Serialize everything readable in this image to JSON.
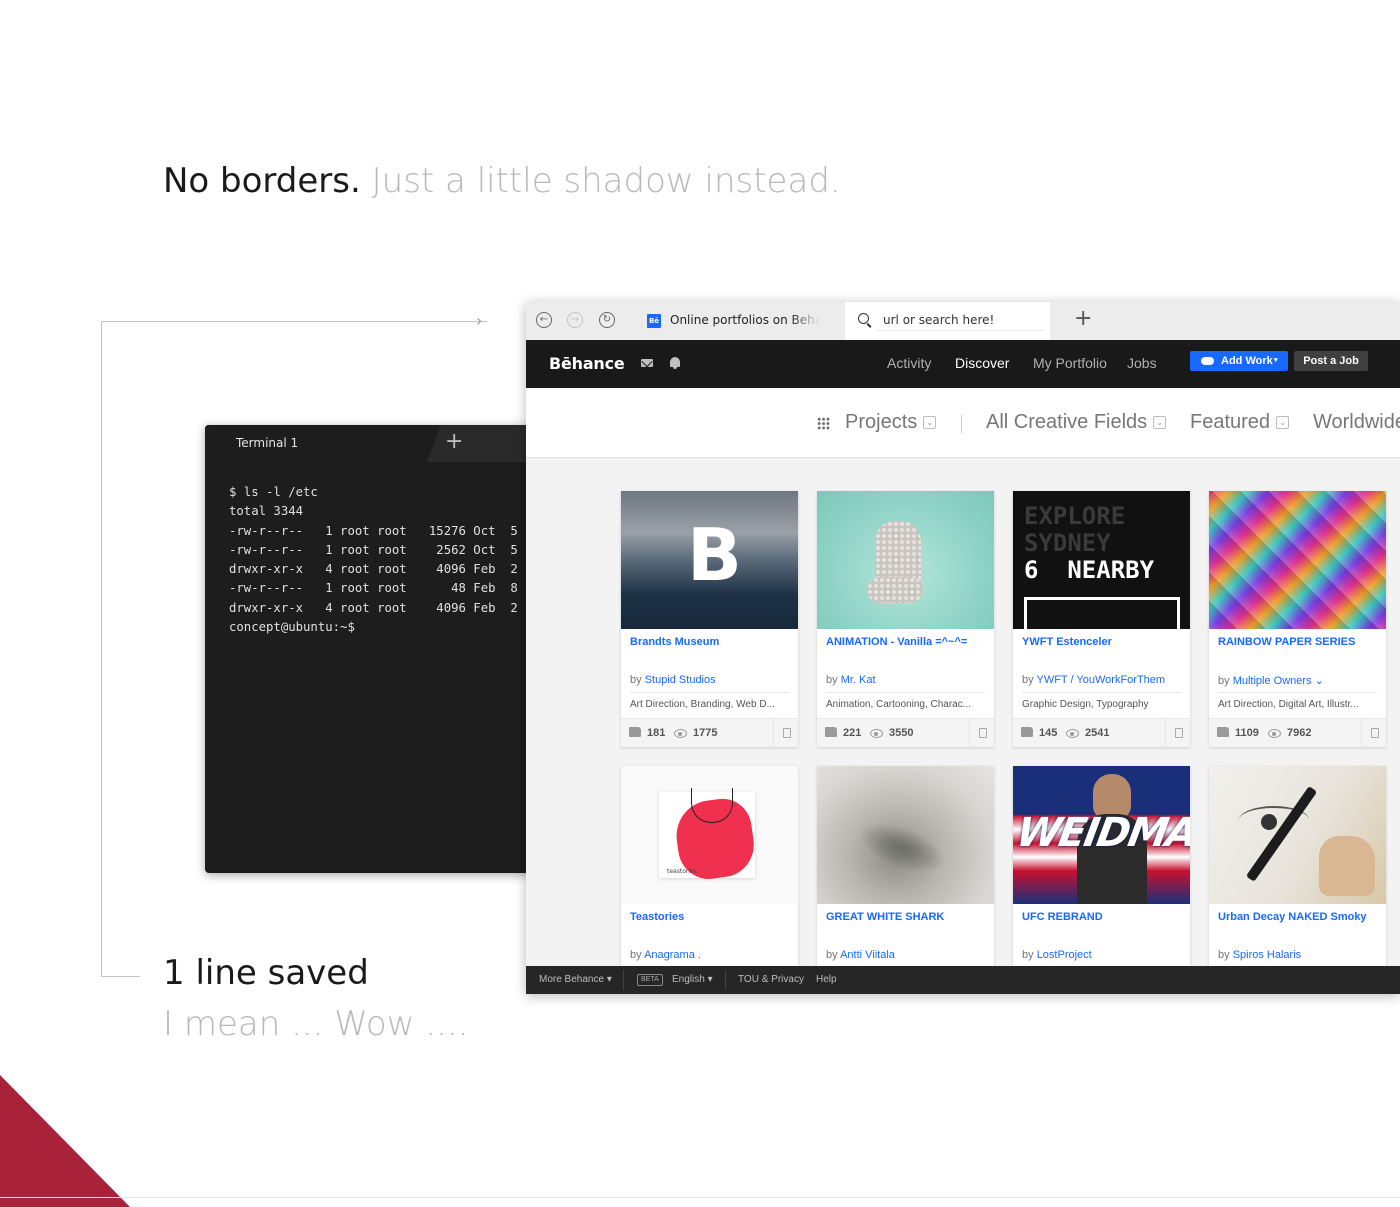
{
  "headline": {
    "bold": "No borders.",
    "light": "Just a little shadow instead."
  },
  "caption": {
    "line1": "1 line saved",
    "line2": "I mean ... Wow ...."
  },
  "terminal": {
    "tab_label": "Terminal 1",
    "new_tab_icon": "+",
    "lines": [
      "$ ls -l /etc",
      "total 3344",
      "-rw-r--r--   1 root root   15276 Oct  5",
      "-rw-r--r--   1 root root    2562 Oct  5",
      "drwxr-xr-x   4 root root    4096 Feb  2",
      "-rw-r--r--   1 root root      48 Feb  8",
      "drwxr-xr-x   4 root root    4096 Feb  2",
      "concept@ubuntu:~$"
    ]
  },
  "browser": {
    "tab_favicon": "Bē",
    "tab_title": "Online portfolios on Behance",
    "url_placeholder": "url or search here!",
    "new_tab_icon": "+",
    "logo": "Bēhance",
    "nav": [
      "Activity",
      "Discover",
      "My Portfolio",
      "Jobs"
    ],
    "add_work": "Add Work",
    "add_work_caret": "▾",
    "post_job": "Post a Job",
    "filters": [
      "Projects",
      "All Creative Fields",
      "Featured",
      "Worldwide"
    ],
    "filter_caret": "⌄",
    "cards": [
      {
        "title": "Brandts Museum",
        "by": "by",
        "author": "Stupid Studios",
        "fields": "Art Direction, Branding, Web D...",
        "appreciations": "181",
        "views": "1775"
      },
      {
        "title": "ANIMATION - Vanilla =^~^=",
        "by": "by",
        "author": "Mr. Kat",
        "fields": "Animation, Cartooning, Charac...",
        "appreciations": "221",
        "views": "3550"
      },
      {
        "title": "YWFT Estenceler",
        "by": "by",
        "author": "YWFT / YouWorkForThem",
        "fields": "Graphic Design, Typography",
        "appreciations": "145",
        "views": "2541"
      },
      {
        "title": "RAINBOW PAPER SERIES",
        "by": "by",
        "author": "Multiple Owners ⌄",
        "fields": "Art Direction, Digital Art, Illustr...",
        "appreciations": "1109",
        "views": "7962"
      },
      {
        "title": "Teastories",
        "by": "by",
        "author": "Anagrama ."
      },
      {
        "title": "GREAT WHITE SHARK",
        "by": "by",
        "author": "Antti Viitala"
      },
      {
        "title": "UFC REBRAND",
        "by": "by",
        "author": "LostProject"
      },
      {
        "title": "Urban Decay NAKED Smoky",
        "by": "by",
        "author": "Spiros Halaris"
      }
    ],
    "thumb_text": {
      "b_letter": "B",
      "explore": [
        "EXPLORE",
        "SYDNEY",
        "6  NEARBY"
      ],
      "weidman": "WEIDMAN",
      "teastories": "teastories"
    },
    "footer": {
      "more": "More Behance ▾",
      "beta": "BETA",
      "language": "English ▾",
      "tou": "TOU & Privacy",
      "help": "Help"
    }
  },
  "colors": {
    "accent": "#1769ff",
    "nav_bg": "#191919",
    "corner": "#a8223a"
  }
}
